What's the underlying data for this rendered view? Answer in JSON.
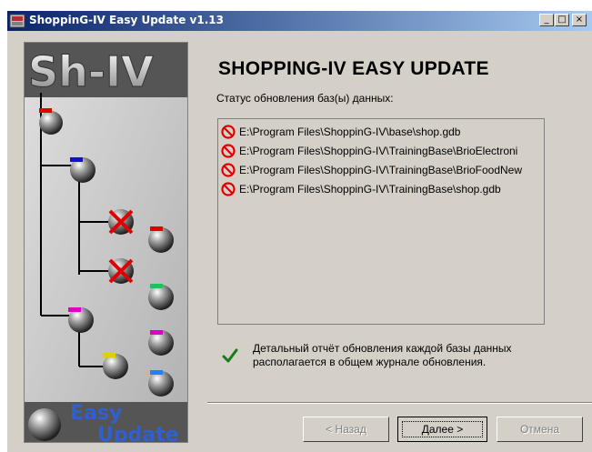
{
  "window": {
    "title": "ShoppinG-IV Easy Update v1.13",
    "controls": {
      "minimize": "_",
      "maximize": "□",
      "close": "×"
    }
  },
  "banner": {
    "logo_text": "Sh-IV",
    "footer_line1": "Easy",
    "footer_line2": "Update"
  },
  "main": {
    "heading": "SHOPPING-IV EASY UPDATE",
    "status_label": "Статус обновления баз(ы) данных:",
    "items": [
      {
        "icon": "no-entry-icon",
        "path": "E:\\Program Files\\ShoppinG-IV\\base\\shop.gdb"
      },
      {
        "icon": "no-entry-icon",
        "path": "E:\\Program Files\\ShoppinG-IV\\TrainingBase\\BrioElectroni"
      },
      {
        "icon": "no-entry-icon",
        "path": "E:\\Program Files\\ShoppinG-IV\\TrainingBase\\BrioFoodNew"
      },
      {
        "icon": "no-entry-icon",
        "path": "E:\\Program Files\\ShoppinG-IV\\TrainingBase\\shop.gdb"
      }
    ],
    "info": {
      "icon": "checkmark-icon",
      "text": "Детальный отчёт обновления каждой базы данных располагается в общем журнале обновления."
    }
  },
  "buttons": {
    "back": "< Назад",
    "next": "Далее >",
    "cancel": "Отмена"
  },
  "colors": {
    "titlebar_start": "#0a246a",
    "titlebar_end": "#a6caf0",
    "face": "#d4d0c8",
    "error": "#e00000",
    "check": "#1a7a1a"
  }
}
